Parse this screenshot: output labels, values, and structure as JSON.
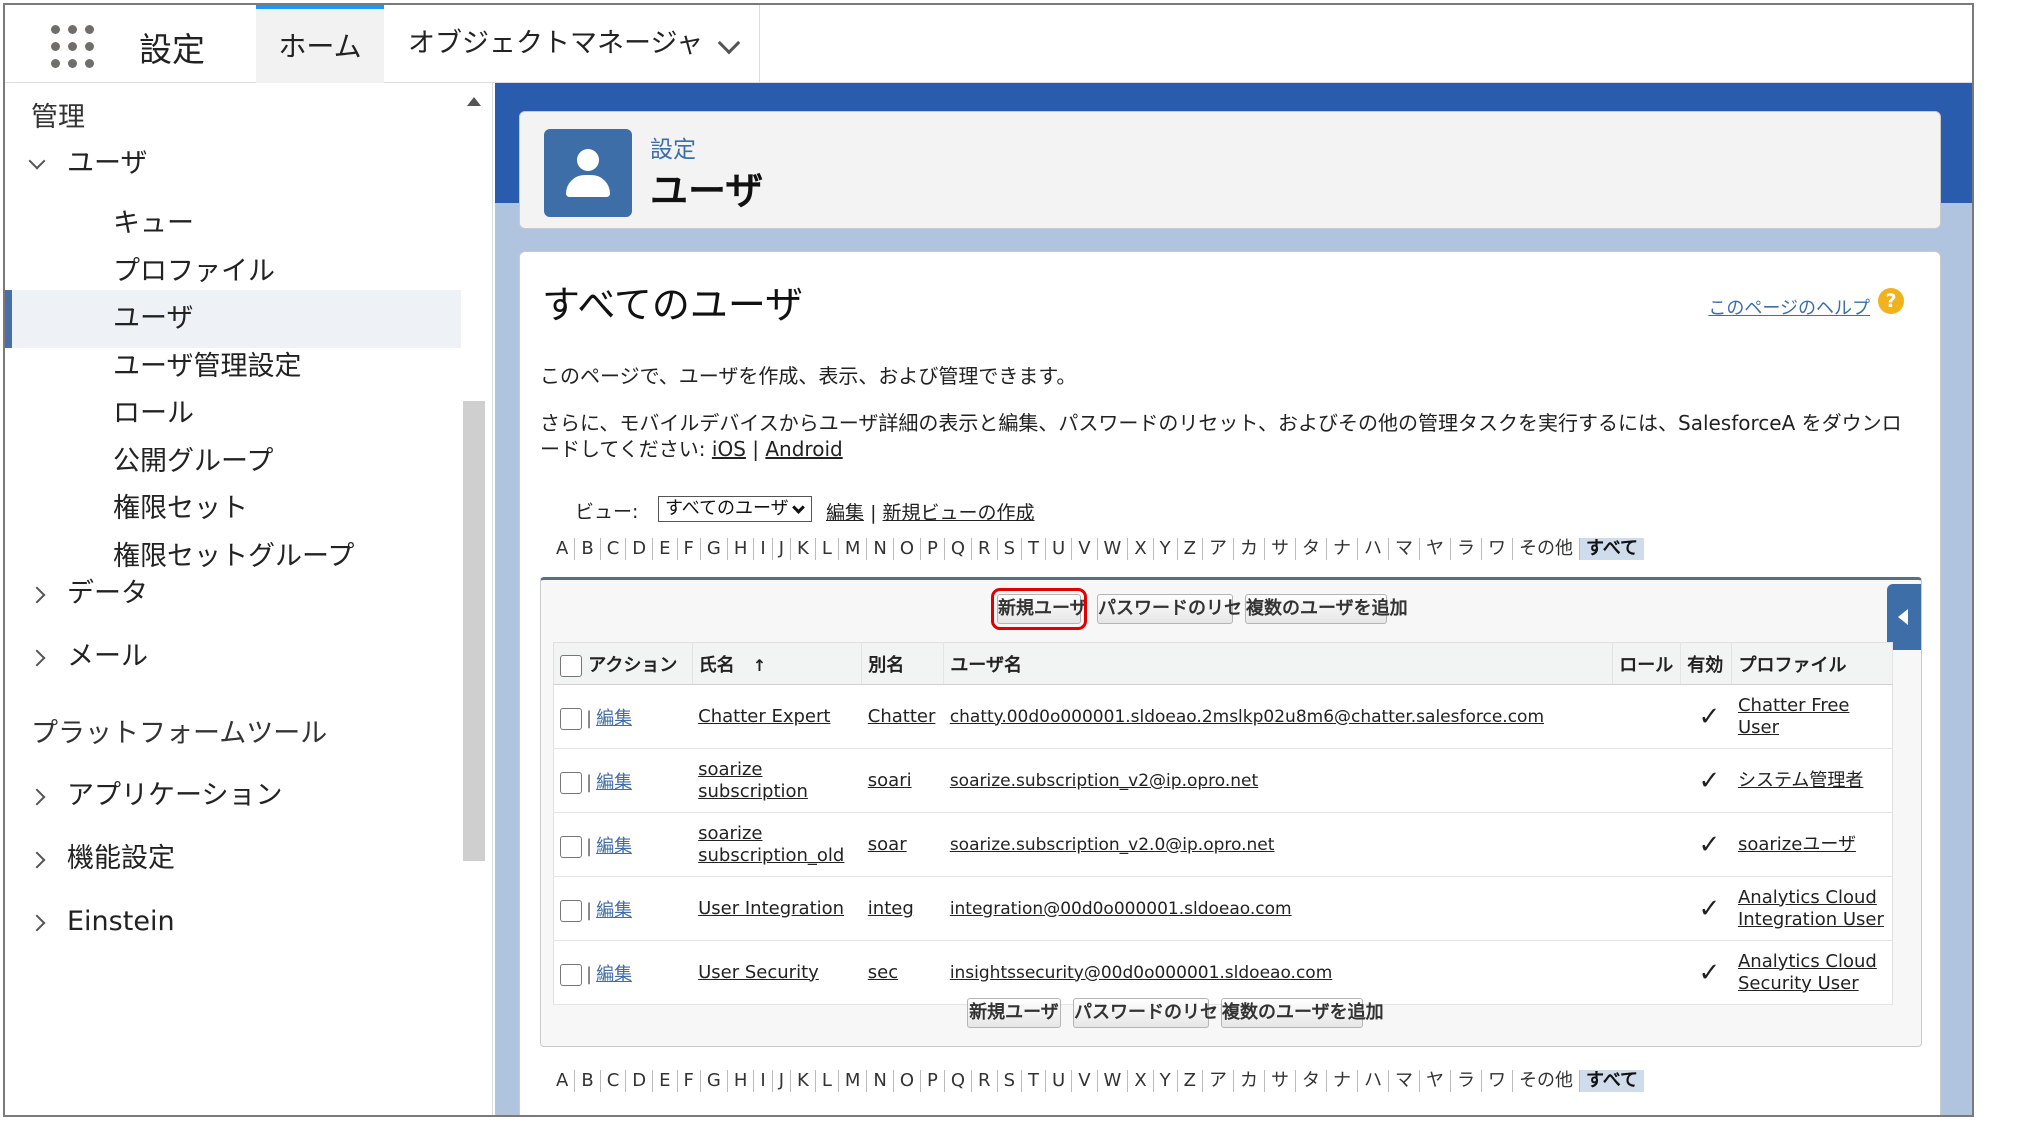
{
  "topbar": {
    "app_name": "設定",
    "tab_home": "ホーム",
    "tab_object_manager": "オブジェクトマネージャ"
  },
  "sidebar": {
    "section": "管理",
    "users_parent": "ユーザ",
    "sub_items": [
      "キュー",
      "プロファイル",
      "ユーザ",
      "ユーザ管理設定",
      "ロール",
      "公開グループ",
      "権限セット",
      "権限セットグループ"
    ],
    "selected_index": 2,
    "data": "データ",
    "mail": "メール",
    "platform_tools": "プラットフォームツール",
    "applications": "アプリケーション",
    "features": "機能設定",
    "einstein": "Einstein"
  },
  "header": {
    "breadcrumb": "設定",
    "title": "ユーザ"
  },
  "page": {
    "title": "すべてのユーザ",
    "help": "このページのヘルプ",
    "help_icon": "?",
    "desc1": "このページで、ユーザを作成、表示、および管理できます。",
    "desc2": "さらに、モバイルデバイスからユーザ詳細の表示と編集、パスワードのリセット、およびその他の管理タスクを実行するには、SalesforceA をダウンロードしてください:",
    "ios": "iOS",
    "sep": "|",
    "android": "Android",
    "view_label": "ビュー:",
    "view_value": "すべてのユーザ",
    "view_edit": "編集",
    "view_new": "新規ビューの作成",
    "alpha": [
      "A",
      "B",
      "C",
      "D",
      "E",
      "F",
      "G",
      "H",
      "I",
      "J",
      "K",
      "L",
      "M",
      "N",
      "O",
      "P",
      "Q",
      "R",
      "S",
      "T",
      "U",
      "V",
      "W",
      "X",
      "Y",
      "Z",
      "ア",
      "カ",
      "サ",
      "タ",
      "ナ",
      "ハ",
      "マ",
      "ヤ",
      "ラ",
      "ワ",
      "その他",
      "すべて"
    ]
  },
  "buttons": {
    "new_user": "新規ユーザ",
    "reset_password": "パスワードのリセット",
    "add_multiple": "複数のユーザを追加"
  },
  "table": {
    "headers": {
      "action": "アクション",
      "name": "氏名",
      "sort": "↑",
      "alias": "別名",
      "username": "ユーザ名",
      "role": "ロール",
      "active": "有効",
      "profile": "プロファイル"
    },
    "edit_label": "編集",
    "rows": [
      {
        "name": "Chatter Expert",
        "alias": "Chatter",
        "username": "chatty.00d0o000001.sldoeao.2mslkp02u8m6@chatter.salesforce.com",
        "active": "✓",
        "profile": "Chatter Free User"
      },
      {
        "name": "soarize subscription",
        "alias": "soari",
        "username": "soarize.subscription_v2@ip.opro.net",
        "active": "✓",
        "profile": "システム管理者"
      },
      {
        "name": "soarize subscription_old",
        "alias": "soar",
        "username": "soarize.subscription_v2.0@ip.opro.net",
        "active": "✓",
        "profile": "soarizeユーザ"
      },
      {
        "name": "User Integration",
        "alias": "integ",
        "username": "integration@00d0o000001.sldoeao.com",
        "active": "✓",
        "profile": "Analytics Cloud Integration User"
      },
      {
        "name": "User Security",
        "alias": "sec",
        "username": "insightssecurity@00d0o000001.sldoeao.com",
        "active": "✓",
        "profile": "Analytics Cloud Security User"
      }
    ]
  }
}
